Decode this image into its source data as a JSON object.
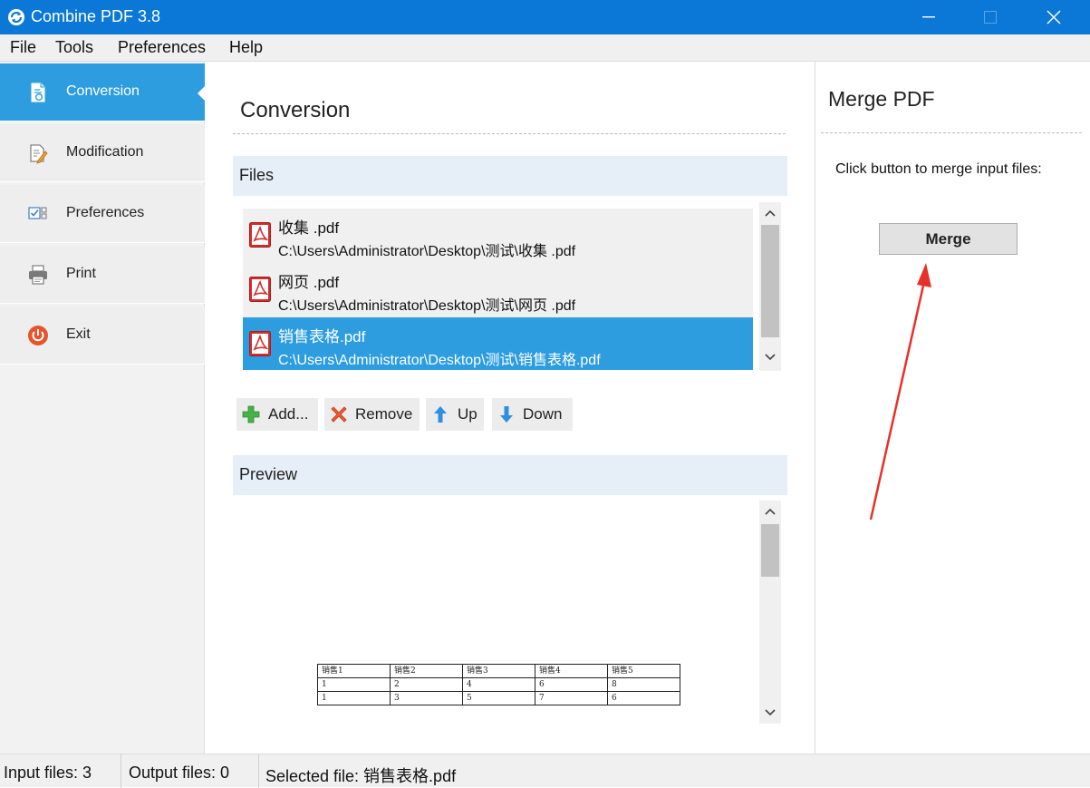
{
  "window": {
    "title": "Combine PDF 3.8"
  },
  "menu": [
    "File",
    "Tools",
    "Preferences",
    "Help"
  ],
  "nav": [
    {
      "label": "Conversion",
      "icon": "convert-document-icon",
      "active": true
    },
    {
      "label": "Modification",
      "icon": "edit-document-icon",
      "active": false
    },
    {
      "label": "Preferences",
      "icon": "preferences-checklist-icon",
      "active": false
    },
    {
      "label": "Print",
      "icon": "printer-icon",
      "active": false
    },
    {
      "label": "Exit",
      "icon": "power-icon",
      "active": false
    }
  ],
  "conversion": {
    "title": "Conversion",
    "files_header": "Files",
    "files": [
      {
        "name": "收集 .pdf",
        "path": "C:\\Users\\Administrator\\Desktop\\测试\\收集 .pdf",
        "selected": false
      },
      {
        "name": "网页 .pdf",
        "path": "C:\\Users\\Administrator\\Desktop\\测试\\网页 .pdf",
        "selected": false
      },
      {
        "name": "销售表格.pdf",
        "path": "C:\\Users\\Administrator\\Desktop\\测试\\销售表格.pdf",
        "selected": true
      }
    ],
    "buttons": {
      "add": "Add...",
      "remove": "Remove",
      "up": "Up",
      "down": "Down"
    },
    "preview_header": "Preview",
    "preview_table": [
      [
        "销售1",
        "销售2",
        "销售3",
        "销售4",
        "销售5"
      ],
      [
        "1",
        "2",
        "4",
        "6",
        "8"
      ],
      [
        "1",
        "3",
        "5",
        "7",
        "6"
      ]
    ]
  },
  "merge": {
    "title": "Merge PDF",
    "hint": "Click button to merge input files:",
    "button": "Merge"
  },
  "status": {
    "input": "Input files: 3",
    "output": "Output files: 0",
    "selected": "Selected file: 销售表格.pdf"
  },
  "colors": {
    "titlebar": "#0b78d7",
    "accent": "#2d9de0",
    "band": "#e6eef7",
    "annotation_arrow": "#e8302a"
  }
}
